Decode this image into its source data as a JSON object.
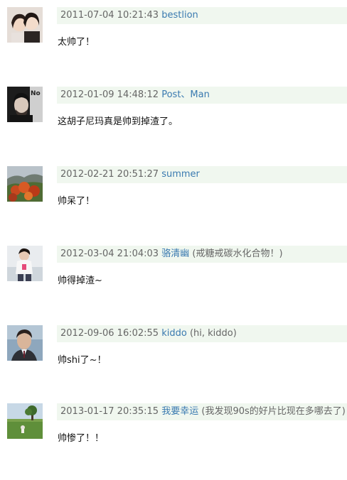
{
  "comments": [
    {
      "time": "2011-07-04 10:21:43",
      "user": "bestlion",
      "signature": "",
      "text": "太帅了！",
      "avatar_theme": "couple-portrait"
    },
    {
      "time": "2012-01-09 14:48:12",
      "user": "Post、Man",
      "signature": "",
      "text": "这胡子尼玛真是帅到掉渣了。",
      "avatar_theme": "man-portrait-dark"
    },
    {
      "time": "2012-02-21 20:51:27",
      "user": "summer",
      "signature": "",
      "text": "帅呆了！",
      "avatar_theme": "autumn-foliage"
    },
    {
      "time": "2012-03-04 21:04:03",
      "user": "骆清幽",
      "signature": "(戒糖戒碳水化合物！)",
      "text": "帅得掉渣~",
      "avatar_theme": "girl-white-shirt"
    },
    {
      "time": "2012-09-06 16:02:55",
      "user": "kiddo",
      "signature": "(hi, kiddo)",
      "text": "帅shi了~！",
      "avatar_theme": "man-suit-portrait"
    },
    {
      "time": "2013-01-17 20:35:15",
      "user": "我要幸运",
      "signature": "(我发现90s的好片比现在多哪去了)",
      "text": "帅惨了！！",
      "avatar_theme": "field-tree-landscape"
    }
  ]
}
